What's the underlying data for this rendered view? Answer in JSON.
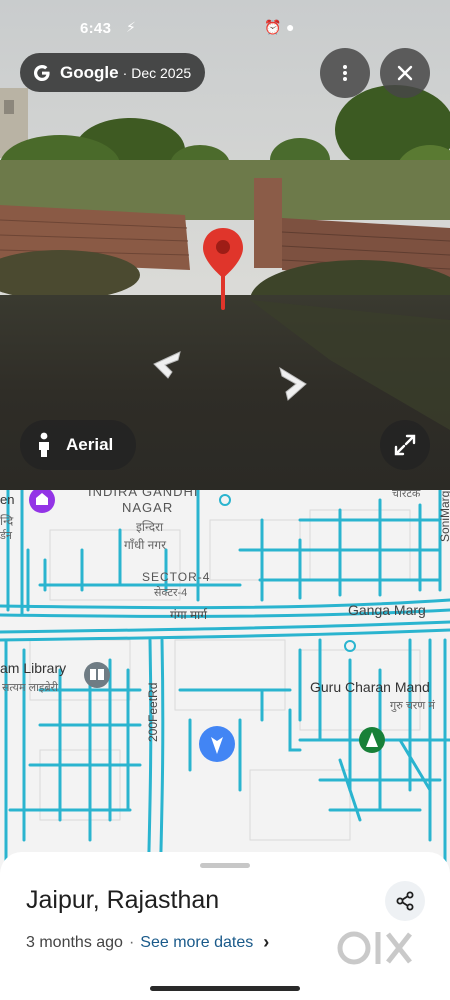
{
  "status_bar": {
    "time": "6:43"
  },
  "street_view": {
    "source_brand": "Google",
    "capture_date": "Dec 2025",
    "aerial_label": "Aerial",
    "icons": {
      "more": "more-vert-icon",
      "close": "close-icon",
      "pin": "red-location-pin-icon",
      "prev": "chevron-left-icon",
      "next": "chevron-right-icon",
      "aerial": "person-icon",
      "expand": "expand-icon"
    }
  },
  "map": {
    "labels": {
      "indira_top": "INDIRA GANDHI",
      "nagar": "NAGAR",
      "indira_hi_1": "इन्दिरा",
      "indira_hi_2": "गाँधी नगर",
      "sector": "SECTOR-4",
      "sector_hi": "सेक्टर-4",
      "ganga_hi": "गंगा मार्ग",
      "ganga_en": "Ganga Marg",
      "library_en": "am Library",
      "library_hi": "सत्यम लाइब्रेरी",
      "guru_en": "Guru Charan Mand",
      "guru_hi": "गुरु चरण मं",
      "road_200": "200FeetRd",
      "soni_marg": "SoniMarg",
      "top_right": "चारटक",
      "left_hi": "न्दि",
      "left_en": "en",
      "left_garden": "र्डन"
    },
    "colors": {
      "coverage_line": "#2ab4cf",
      "background": "#f3f3f3",
      "poi_green": "#188038",
      "poi_purple": "#9334e6",
      "location_arrow": "#4285f4"
    }
  },
  "sheet": {
    "title": "Jaipur, Rajasthan",
    "ago": "3 months ago",
    "separator": "·",
    "see_more": "See more dates",
    "watermark": "OLX"
  }
}
